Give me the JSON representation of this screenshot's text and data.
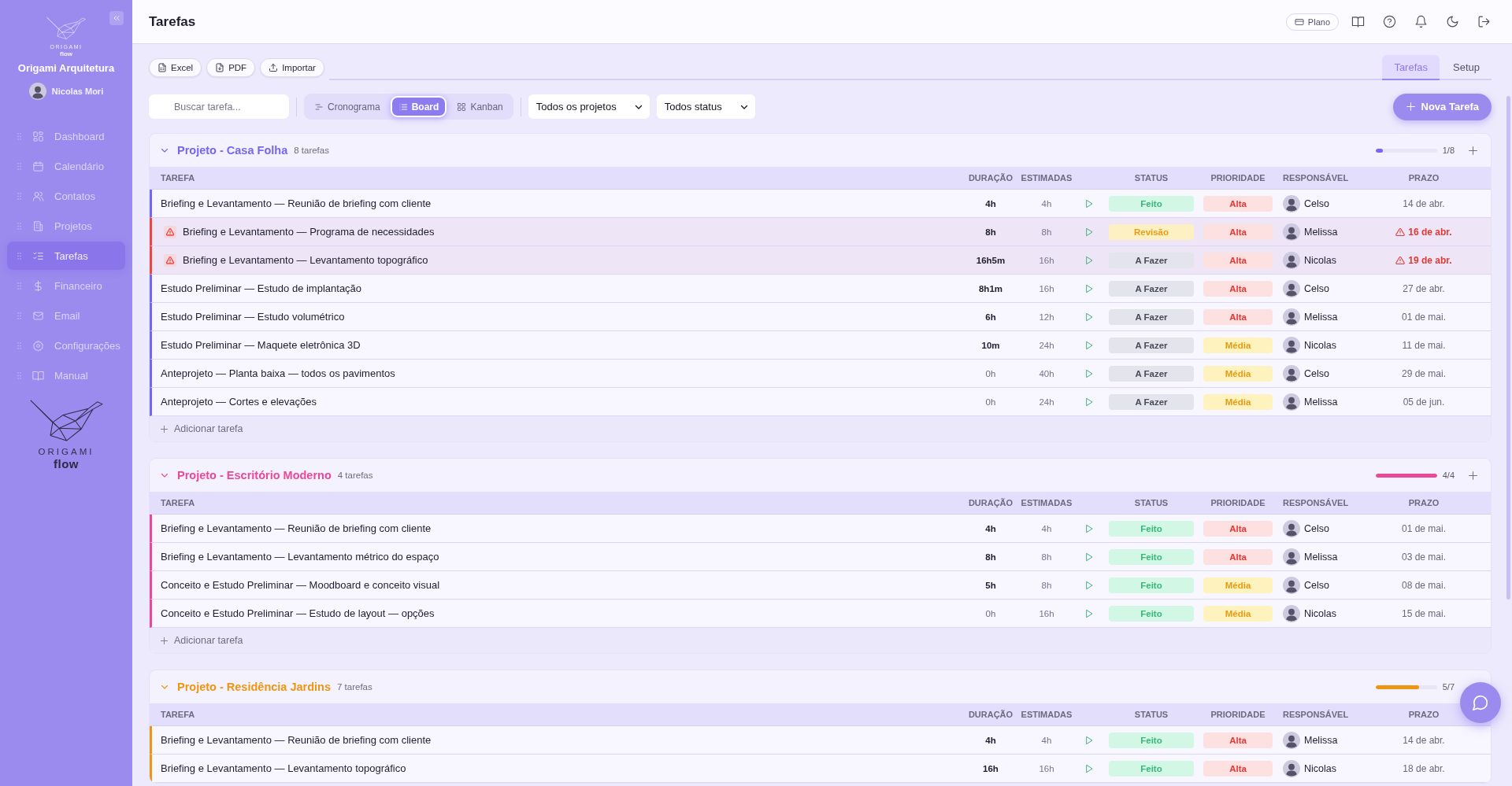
{
  "sidebar": {
    "logo": {
      "wordmark": "ORIGAMI",
      "tagline": "flow"
    },
    "workspace": "Origami Arquitetura",
    "user": {
      "name": "Nicolas Mori"
    },
    "items": [
      {
        "label": "Dashboard",
        "selected": false
      },
      {
        "label": "Calendário",
        "selected": false
      },
      {
        "label": "Contatos",
        "selected": false
      },
      {
        "label": "Projetos",
        "selected": false
      },
      {
        "label": "Tarefas",
        "selected": true
      },
      {
        "label": "Financeiro",
        "selected": false
      },
      {
        "label": "Email",
        "selected": false
      },
      {
        "label": "Configurações",
        "selected": false
      },
      {
        "label": "Manual",
        "selected": false
      }
    ],
    "footer_logo": {
      "wordmark": "ORIGAMI",
      "tagline": "flow"
    }
  },
  "header": {
    "title": "Tarefas",
    "plan_button": "Plano"
  },
  "export_buttons": [
    "Excel",
    "PDF",
    "Importar"
  ],
  "tabs": [
    {
      "label": "Tarefas",
      "selected": true
    },
    {
      "label": "Setup",
      "selected": false
    }
  ],
  "toolbar": {
    "search": {
      "placeholder": "Buscar tarefa..."
    },
    "views": [
      {
        "label": "Cronograma",
        "selected": false
      },
      {
        "label": "Board",
        "selected": true
      },
      {
        "label": "Kanban",
        "selected": false
      }
    ],
    "filters": [
      {
        "value": "Todos os projetos"
      },
      {
        "value": "Todos status"
      }
    ],
    "new_button": "Nova Tarefa"
  },
  "groups": [
    {
      "title": "Projeto - Casa Folha",
      "task_count": "8 tarefas",
      "color": "#7567f0",
      "expanded": true,
      "progress": {
        "level": 0.125,
        "label": "1/8"
      },
      "add_icon": true,
      "columns": [
        "TAREFA",
        "DURAÇÃO",
        "ESTIMADAS",
        "STATUS",
        "PRIORIDADE",
        "RESPONSÁVEL",
        "PRAZO"
      ],
      "rows": [
        {
          "task": "Briefing e Levantamento — Reunião de briefing com cliente",
          "overdue": false,
          "duration": "4h",
          "logged": true,
          "estimate": "4h",
          "status": {
            "label": "Feito",
            "kind": "done"
          },
          "priority": {
            "label": "Alta",
            "kind": "high"
          },
          "assignee": "Celso",
          "due": "14 de abr."
        },
        {
          "task": "Briefing e Levantamento — Programa de necessidades",
          "overdue": true,
          "duration": "8h",
          "logged": true,
          "estimate": "8h",
          "status": {
            "label": "Revisão",
            "kind": "review"
          },
          "priority": {
            "label": "Alta",
            "kind": "high"
          },
          "assignee": "Melissa",
          "due": "16 de abr."
        },
        {
          "task": "Briefing e Levantamento — Levantamento topográfico",
          "overdue": true,
          "duration": "16h5m",
          "logged": true,
          "estimate": "16h",
          "status": {
            "label": "A Fazer",
            "kind": "todo"
          },
          "priority": {
            "label": "Alta",
            "kind": "high"
          },
          "assignee": "Nicolas",
          "due": "19 de abr."
        },
        {
          "task": "Estudo Preliminar — Estudo de implantação",
          "overdue": false,
          "duration": "8h1m",
          "logged": true,
          "estimate": "16h",
          "status": {
            "label": "A Fazer",
            "kind": "todo"
          },
          "priority": {
            "label": "Alta",
            "kind": "high"
          },
          "assignee": "Celso",
          "due": "27 de abr."
        },
        {
          "task": "Estudo Preliminar — Estudo volumétrico",
          "overdue": false,
          "duration": "6h",
          "logged": true,
          "estimate": "12h",
          "status": {
            "label": "A Fazer",
            "kind": "todo"
          },
          "priority": {
            "label": "Alta",
            "kind": "high"
          },
          "assignee": "Melissa",
          "due": "01 de mai."
        },
        {
          "task": "Estudo Preliminar — Maquete eletrônica 3D",
          "overdue": false,
          "duration": "10m",
          "logged": true,
          "estimate": "24h",
          "status": {
            "label": "A Fazer",
            "kind": "todo"
          },
          "priority": {
            "label": "Média",
            "kind": "medium"
          },
          "assignee": "Nicolas",
          "due": "11 de mai."
        },
        {
          "task": "Anteprojeto — Planta baixa — todos os pavimentos",
          "overdue": false,
          "duration": "0h",
          "logged": false,
          "estimate": "40h",
          "status": {
            "label": "A Fazer",
            "kind": "todo"
          },
          "priority": {
            "label": "Média",
            "kind": "medium"
          },
          "assignee": "Celso",
          "due": "29 de mai."
        },
        {
          "task": "Anteprojeto — Cortes e elevações",
          "overdue": false,
          "duration": "0h",
          "logged": false,
          "estimate": "24h",
          "status": {
            "label": "A Fazer",
            "kind": "todo"
          },
          "priority": {
            "label": "Média",
            "kind": "medium"
          },
          "assignee": "Melissa",
          "due": "05 de jun."
        }
      ],
      "add_label": "Adicionar tarefa"
    },
    {
      "title": "Projeto - Escritório Moderno",
      "task_count": "4 tarefas",
      "color": "#ec4899",
      "expanded": true,
      "progress": {
        "level": 1,
        "label": "4/4"
      },
      "add_icon": true,
      "columns": [
        "TAREFA",
        "DURAÇÃO",
        "ESTIMADAS",
        "STATUS",
        "PRIORIDADE",
        "RESPONSÁVEL",
        "PRAZO"
      ],
      "rows": [
        {
          "task": "Briefing e Levantamento — Reunião de briefing com cliente",
          "overdue": false,
          "duration": "4h",
          "logged": true,
          "estimate": "4h",
          "status": {
            "label": "Feito",
            "kind": "done"
          },
          "priority": {
            "label": "Alta",
            "kind": "high"
          },
          "assignee": "Celso",
          "due": "01 de mai."
        },
        {
          "task": "Briefing e Levantamento — Levantamento métrico do espaço",
          "overdue": false,
          "duration": "8h",
          "logged": true,
          "estimate": "8h",
          "status": {
            "label": "Feito",
            "kind": "done"
          },
          "priority": {
            "label": "Alta",
            "kind": "high"
          },
          "assignee": "Melissa",
          "due": "03 de mai."
        },
        {
          "task": "Conceito e Estudo Preliminar — Moodboard e conceito visual",
          "overdue": false,
          "duration": "5h",
          "logged": true,
          "estimate": "8h",
          "status": {
            "label": "Feito",
            "kind": "done"
          },
          "priority": {
            "label": "Média",
            "kind": "medium"
          },
          "assignee": "Celso",
          "due": "08 de mai."
        },
        {
          "task": "Conceito e Estudo Preliminar — Estudo de layout — opções",
          "overdue": false,
          "duration": "0h",
          "logged": false,
          "estimate": "16h",
          "status": {
            "label": "Feito",
            "kind": "done"
          },
          "priority": {
            "label": "Média",
            "kind": "medium"
          },
          "assignee": "Nicolas",
          "due": "15 de mai."
        }
      ],
      "add_label": "Adicionar tarefa"
    },
    {
      "title": "Projeto - Residência Jardins",
      "task_count": "7 tarefas",
      "color": "#ee9612",
      "expanded": true,
      "progress": {
        "level": 0.714,
        "label": "5/7"
      },
      "add_icon": false,
      "columns": [
        "TAREFA",
        "DURAÇÃO",
        "ESTIMADAS",
        "STATUS",
        "PRIORIDADE",
        "RESPONSÁVEL",
        "PRAZO"
      ],
      "rows": [
        {
          "task": "Briefing e Levantamento — Reunião de briefing com cliente",
          "overdue": false,
          "duration": "4h",
          "logged": true,
          "estimate": "4h",
          "status": {
            "label": "Feito",
            "kind": "done"
          },
          "priority": {
            "label": "Alta",
            "kind": "high"
          },
          "assignee": "Melissa",
          "due": "14 de abr."
        },
        {
          "task": "Briefing e Levantamento — Levantamento topográfico",
          "overdue": false,
          "duration": "16h",
          "logged": true,
          "estimate": "16h",
          "status": {
            "label": "Feito",
            "kind": "done"
          },
          "priority": {
            "label": "Alta",
            "kind": "high"
          },
          "assignee": "Nicolas",
          "due": "18 de abr."
        }
      ]
    }
  ]
}
